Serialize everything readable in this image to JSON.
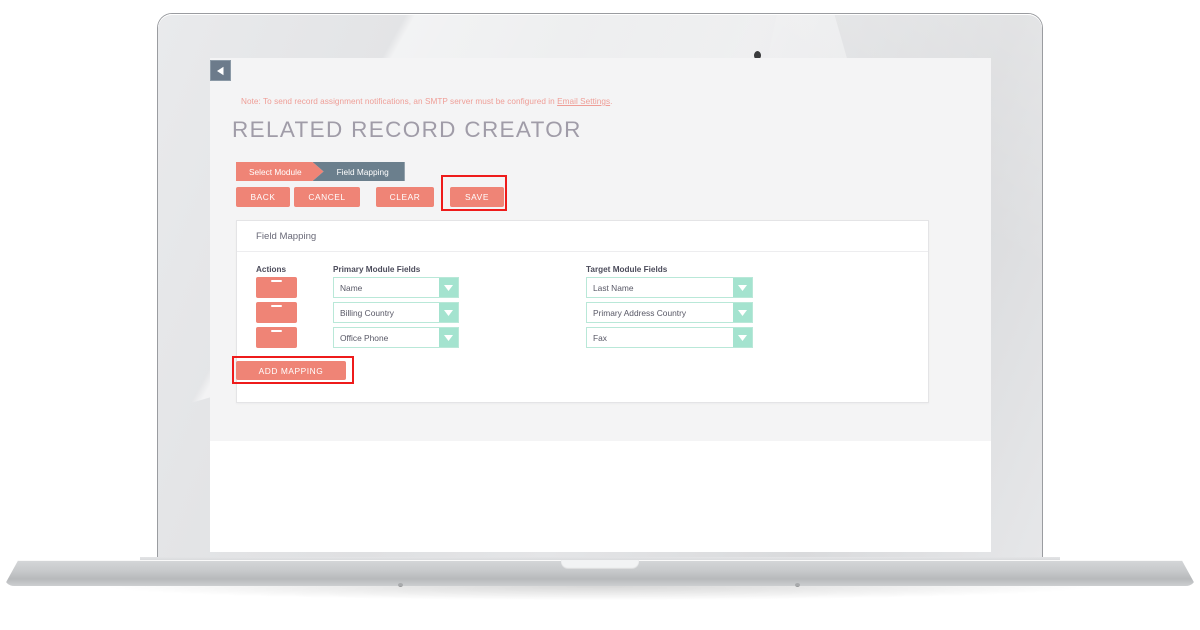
{
  "device": {
    "type": "laptop-mockup",
    "camera_icon": "camera-dot-icon"
  },
  "screen": {
    "back_tab_icon": "back-triangle-icon",
    "note": {
      "prefix": "Note: To send record assignment notifications, an SMTP server must be configured in ",
      "link_label": "Email Settings",
      "suffix": ".",
      "color": "#ef9e97"
    },
    "page_title": "RELATED RECORD CREATOR",
    "steps": [
      {
        "label": "Select Module",
        "state": "done",
        "color": "#ef8476"
      },
      {
        "label": "Field Mapping",
        "state": "current",
        "color": "#6b7f8d"
      }
    ],
    "toolbar": {
      "back_label": "BACK",
      "cancel_label": "CANCEL",
      "clear_label": "CLEAR",
      "save_label": "SAVE"
    },
    "card": {
      "title": "Field Mapping",
      "columns": {
        "actions": "Actions",
        "primary": "Primary Module Fields",
        "target": "Target Module Fields"
      },
      "rows": [
        {
          "remove_icon": "minus-icon",
          "primary_value": "Name",
          "target_value": "Last Name"
        },
        {
          "remove_icon": "minus-icon",
          "primary_value": "Billing Country",
          "target_value": "Primary Address Country"
        },
        {
          "remove_icon": "minus-icon",
          "primary_value": "Office Phone",
          "target_value": "Fax"
        }
      ],
      "dropdown_icon": "chevron-down-icon"
    },
    "add_mapping_label": "ADD MAPPING",
    "highlights": [
      {
        "target": "save-button",
        "color": "#ee1b1b"
      },
      {
        "target": "add-mapping-button",
        "color": "#ee1b1b"
      }
    ]
  },
  "colors": {
    "accent_coral": "#ef8476",
    "accent_mint": "#a4e3cf",
    "step_current": "#6b7f8d",
    "title_gray": "#a09ca8",
    "page_bg": "#f4f4f5",
    "highlight_red": "#ee1b1b"
  }
}
